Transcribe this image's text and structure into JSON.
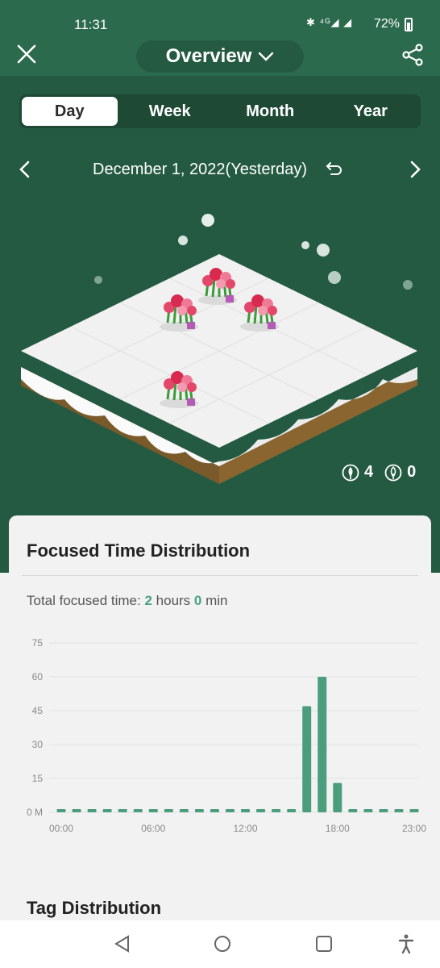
{
  "status": {
    "time": "11:31",
    "battery": "72%"
  },
  "header": {
    "title": "Overview"
  },
  "tabs": [
    "Day",
    "Week",
    "Month",
    "Year"
  ],
  "active_tab": "Day",
  "date": {
    "label": "December 1, 2022(Yesterday)"
  },
  "forest": {
    "healthy_count": "4",
    "withered_count": "0"
  },
  "focus_card": {
    "title": "Focused Time Distribution",
    "total_prefix": "Total focused time: ",
    "hours": "2",
    "hours_label": " hours ",
    "minutes": "0",
    "minutes_label": " min"
  },
  "chart_data": {
    "type": "bar",
    "x": [
      0,
      1,
      2,
      3,
      4,
      5,
      6,
      7,
      8,
      9,
      10,
      11,
      12,
      13,
      14,
      15,
      16,
      17,
      18,
      19,
      20,
      21,
      22,
      23
    ],
    "x_tick_labels": [
      "00:00",
      "06:00",
      "12:00",
      "18:00",
      "23:00"
    ],
    "x_tick_hours": [
      0,
      6,
      12,
      18,
      23
    ],
    "values": [
      0,
      0,
      0,
      0,
      0,
      0,
      0,
      0,
      0,
      0,
      0,
      0,
      0,
      0,
      0,
      0,
      47,
      60,
      13,
      0,
      0,
      0,
      0,
      0
    ],
    "y_ticks": [
      "0 M",
      "15",
      "30",
      "45",
      "60",
      "75"
    ],
    "ylim": [
      0,
      75
    ],
    "grid": true,
    "bar_color": "#4a9e7b"
  },
  "tag_card": {
    "title": "Tag Distribution"
  },
  "colors": {
    "forest_bg": "#245a42",
    "accent": "#4aa37d"
  }
}
